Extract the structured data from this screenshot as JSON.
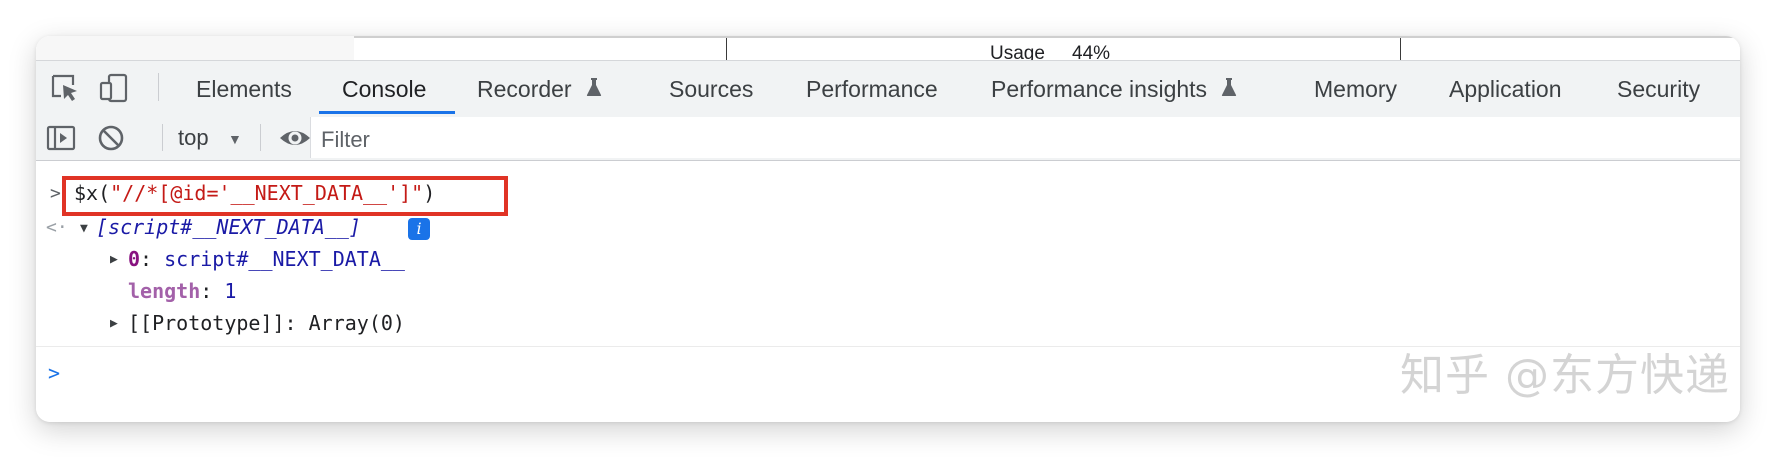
{
  "page_behind": {
    "usage_label": "Usage",
    "usage_value": "44%"
  },
  "tabs": [
    {
      "label": "Elements"
    },
    {
      "label": "Console",
      "active": true
    },
    {
      "label": "Recorder",
      "icon": "flask-icon"
    },
    {
      "label": "Sources"
    },
    {
      "label": "Performance"
    },
    {
      "label": "Performance insights",
      "icon": "flask-icon"
    },
    {
      "label": "Memory"
    },
    {
      "label": "Application"
    },
    {
      "label": "Security"
    }
  ],
  "toolbar": {
    "context": "top",
    "filter_placeholder": "Filter"
  },
  "console": {
    "command_prefix": "$x(",
    "command_string": "\"//*[@id='__NEXT_DATA__']\"",
    "command_suffix": ")",
    "result_summary": "[script#__NEXT_DATA__]",
    "info_badge": "i",
    "entries": [
      {
        "key": "0",
        "sep": ": ",
        "value": "script#__NEXT_DATA__"
      },
      {
        "key": "length",
        "sep": ": ",
        "value": "1"
      },
      {
        "key": "[[Prototype]]",
        "sep": ": ",
        "value": "Array(0)"
      }
    ]
  },
  "watermark": "知乎 @东方快递",
  "colors": {
    "accent": "#1a73e8",
    "highlight_box": "#e03325",
    "string": "#c41a16",
    "key": "#881280"
  }
}
